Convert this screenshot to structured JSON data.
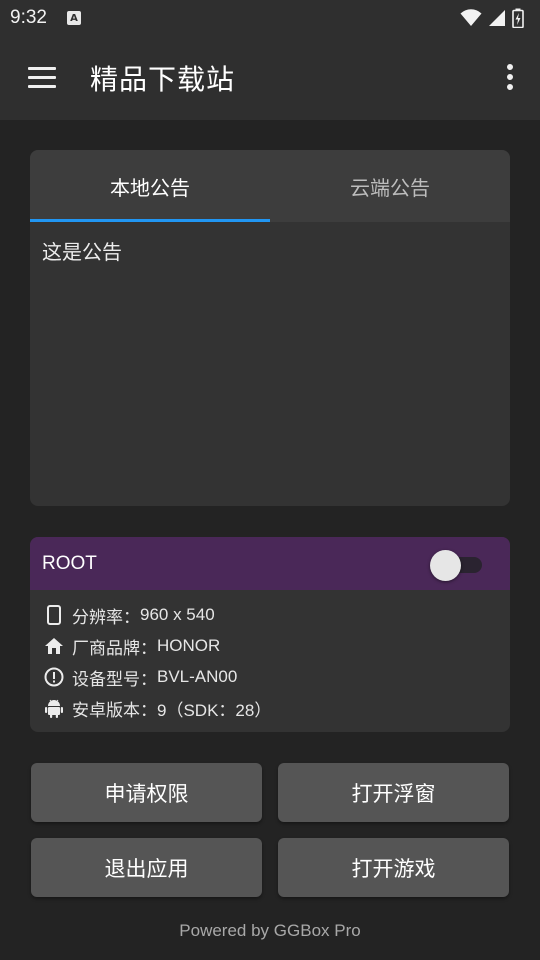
{
  "status_bar": {
    "time": "9:32",
    "icons": [
      "a-notification-icon",
      "wifi-icon",
      "signal-icon",
      "battery-icon"
    ]
  },
  "app_bar": {
    "title": "精品下载站",
    "icons": [
      "menu-icon",
      "more-vertical-icon"
    ]
  },
  "notice": {
    "tabs": [
      {
        "label": "本地公告",
        "active": true
      },
      {
        "label": "云端公告",
        "active": false
      }
    ],
    "content": "这是公告",
    "indicator_color": "#2196f3"
  },
  "device_info": {
    "root_label": "ROOT",
    "root_enabled": false,
    "header_color": "#4a2858",
    "rows": [
      {
        "icon": "phone-icon",
        "label": "分辨率：",
        "value": "960 x 540"
      },
      {
        "icon": "home-icon",
        "label": "厂商品牌：",
        "value": "HONOR"
      },
      {
        "icon": "alert-circle-icon",
        "label": "设备型号：",
        "value": "BVL-AN00"
      },
      {
        "icon": "android-icon",
        "label": "安卓版本：",
        "value": "9（SDK：28）"
      }
    ]
  },
  "buttons": {
    "request_permission": "申请权限",
    "open_floating": "打开浮窗",
    "exit_app": "退出应用",
    "open_game": "打开游戏"
  },
  "footer": "Powered by GGBox Pro"
}
